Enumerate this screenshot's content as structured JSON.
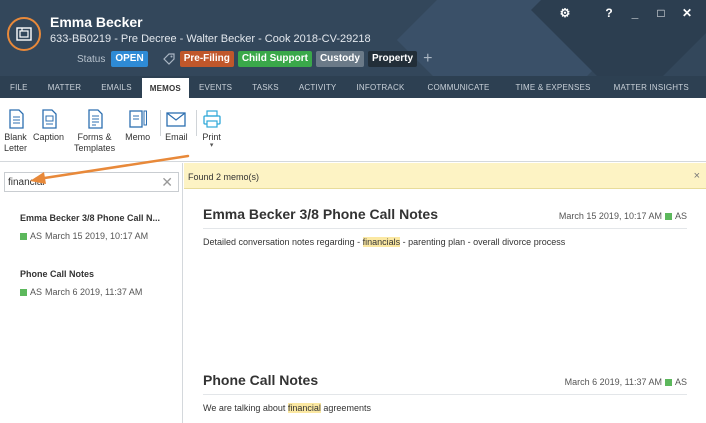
{
  "header": {
    "client_name": "Emma Becker",
    "matter_line": "633-BB0219 - Pre Decree - Walter Becker - Cook 2018-CV-29218",
    "status_label": "Status",
    "status_value": "OPEN",
    "tags": [
      {
        "label": "Pre-Filing",
        "color": "#c0572b"
      },
      {
        "label": "Child Support",
        "color": "#3aa84a"
      },
      {
        "label": "Custody",
        "color": "#6b7a88"
      },
      {
        "label": "Property",
        "color": "#222e38"
      }
    ],
    "status_color": "#2e8bd6",
    "add_tag": "+",
    "window": {
      "gear": "⚙",
      "help": "?",
      "minimize": "_",
      "maximize": "□",
      "close": "✕"
    }
  },
  "nav": {
    "items": [
      "FILE",
      "MATTER",
      "EMAILS",
      "MEMOS",
      "EVENTS",
      "TASKS",
      "ACTIVITY",
      "INFOTRACK",
      "COMMUNICATE",
      "TIME & EXPENSES",
      "MATTER INSIGHTS"
    ],
    "active": "MEMOS"
  },
  "toolbar": {
    "blank_letter": [
      "Blank",
      "Letter"
    ],
    "caption": "Caption",
    "forms_templates": [
      "Forms &",
      "Templates"
    ],
    "memo": "Memo",
    "email": "Email",
    "print": "Print",
    "print_caret": "▾"
  },
  "search": {
    "value": "financial",
    "clear": "✕"
  },
  "memo_list": [
    {
      "title": "Emma Becker 3/8 Phone Call N...",
      "initials": "AS",
      "date": "March 15 2019, 10:17 AM"
    },
    {
      "title": "Phone Call Notes",
      "initials": "AS",
      "date": "March 6 2019, 11:37 AM"
    }
  ],
  "results": {
    "found_text": "Found 2 memo(s)",
    "close": "×"
  },
  "memos": [
    {
      "title": "Emma Becker 3/8 Phone Call Notes",
      "date": "March 15 2019, 10:17 AM",
      "initials": "AS",
      "body_before": "Detailed conversation notes regarding  - ",
      "body_highlight": "financials",
      "body_after": "  - parenting plan  - overall divorce process"
    },
    {
      "title": "Phone Call Notes",
      "date": "March 6 2019, 11:37 AM",
      "initials": "AS",
      "body_before": "We are talking about ",
      "body_highlight": "financial",
      "body_after": " agreements"
    }
  ],
  "colors": {
    "header_bg": "#33475b",
    "accent_orange": "#e8893a",
    "highlight": "#fbe8a2",
    "found_bar": "#fdf3c4",
    "status_square": "#5cb85c"
  }
}
